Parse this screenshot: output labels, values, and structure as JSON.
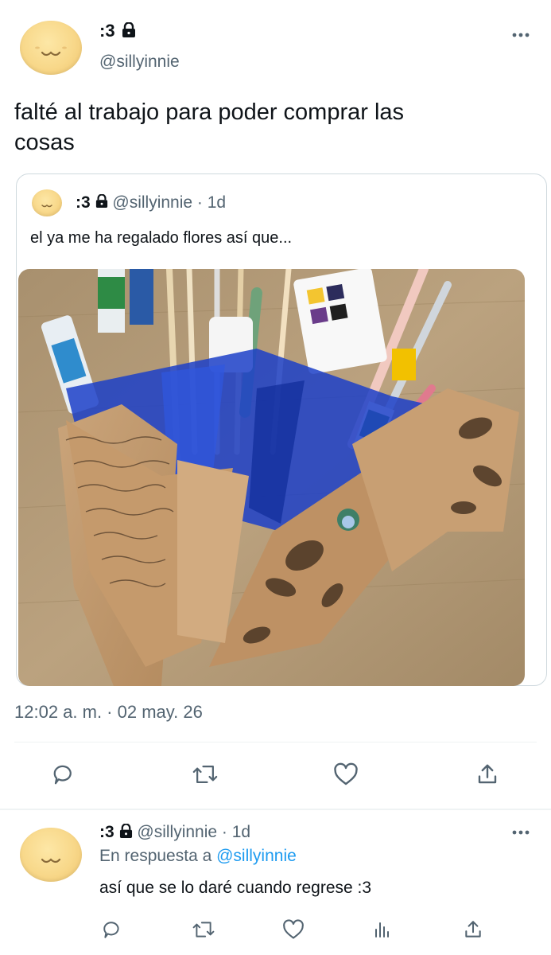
{
  "main_tweet": {
    "display_name": ":3",
    "handle": "@sillyinnie",
    "text_line1": "falté al trabajo para poder comprar las",
    "text_line2": "cosas",
    "timestamp": "12:02 a. m. · 02 may. 26",
    "more_icon": "more-horizontal-icon"
  },
  "quoted_tweet": {
    "display_name": ":3",
    "handle": "@sillyinnie",
    "time_ago": "· 1d",
    "text": "el ya me ha regalado flores así que..."
  },
  "actions": {
    "icons": [
      "reply-icon",
      "retweet-icon",
      "like-icon",
      "share-icon"
    ]
  },
  "reply_tweet": {
    "display_name": ":3",
    "handle": "@sillyinnie",
    "time_ago": "· 1d",
    "replying_prefix": "En respuesta a",
    "replying_to": "@sillyinnie",
    "text": "así que se lo daré cuando regrese :3",
    "icons": [
      "reply-icon",
      "retweet-icon",
      "like-icon",
      "analytics-icon",
      "share-icon"
    ]
  },
  "colors": {
    "accent": "#1d9bf0",
    "muted": "#536471",
    "border": "#cfd9de"
  }
}
